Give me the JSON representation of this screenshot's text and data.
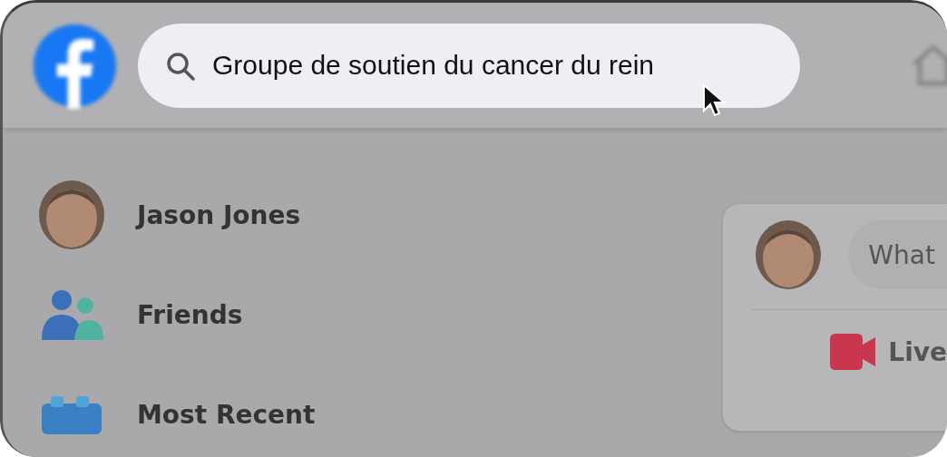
{
  "top_bar": {
    "search": {
      "value": "Groupe de soutien du cancer du rein"
    }
  },
  "sidebar": {
    "items": [
      {
        "kind": "profile",
        "label": "Jason Jones"
      },
      {
        "kind": "friends",
        "label": "Friends"
      },
      {
        "kind": "recent",
        "label": "Most Recent"
      }
    ]
  },
  "composer": {
    "placeholder": "What",
    "actions": [
      {
        "kind": "live",
        "label": "Live"
      }
    ]
  }
}
